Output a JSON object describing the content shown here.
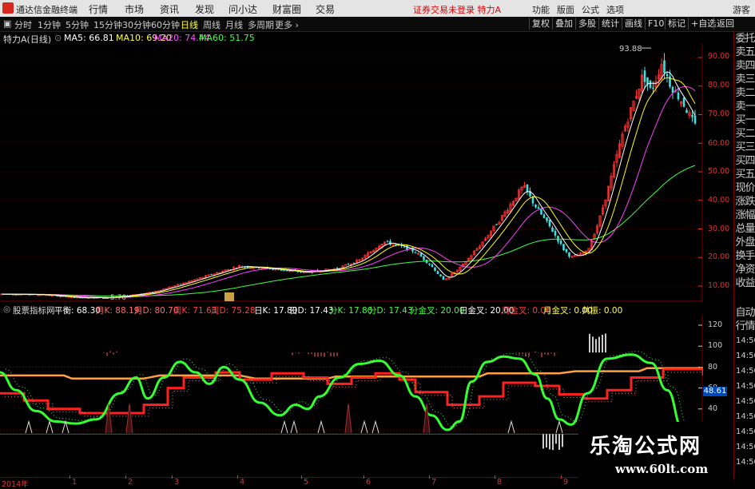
{
  "titlebar": {
    "app_name": "通达信金融终端",
    "menus": [
      "行情",
      "市场",
      "资讯",
      "发现",
      "问小达",
      "财富圈",
      "交易"
    ],
    "warning": "证券交易未登录",
    "stock": "特力A",
    "right_menus": [
      "功能",
      "版面",
      "公式",
      "选项"
    ],
    "guest": "游客"
  },
  "periods": [
    "分时",
    "1分钟",
    "5分钟",
    "15分钟",
    "30分钟",
    "60分钟",
    "日线",
    "周线",
    "月线",
    "多周期",
    "更多"
  ],
  "active_period": "日线",
  "toolbar_buttons": [
    "复权",
    "叠加",
    "多股",
    "统计",
    "画线",
    "F10",
    "标记",
    "+自选",
    "返回"
  ],
  "main_header": {
    "stock_label": "特力A(日线)",
    "ma5": "MA5: 66.81",
    "ma10": "MA10: 69.20",
    "ma20": "MA20: 74.44",
    "ma60": "MA60: 51.75"
  },
  "price_axis": [
    "90.00",
    "80.00",
    "70.00",
    "60.00",
    "50.00",
    "40.00",
    "30.00",
    "20.00",
    "10.00"
  ],
  "peak_label": "93.88",
  "low_label": "5.70",
  "indicator_header": {
    "name": "股票指标网",
    "items": [
      {
        "label": "平衡: 68.30",
        "color": "#ffffff"
      },
      {
        "label": "月K: 88.19",
        "color": "#ff6b6b"
      },
      {
        "label": "月D: 80.70",
        "color": "#ff6b6b"
      },
      {
        "label": "周K: 71.63",
        "color": "#ff4040"
      },
      {
        "label": "周D: 75.28",
        "color": "#ff4040"
      },
      {
        "label": "日K: 17.80",
        "color": "#ffffff"
      },
      {
        "label": "日D: 17.43",
        "color": "#ffffff"
      },
      {
        "label": "分K: 17.80",
        "color": "#44ff44"
      },
      {
        "label": "分D: 17.43",
        "color": "#44ff44"
      },
      {
        "label": "分金叉: 20.00",
        "color": "#44ff44"
      },
      {
        "label": "日金叉: 20.00",
        "color": "#ffffff"
      },
      {
        "label": "周金叉: 0.00",
        "color": "#ff4040"
      },
      {
        "label": "月金叉: 0.00",
        "color": "#ffff44"
      },
      {
        "label": "共振: 0.00",
        "color": "#ffff44"
      }
    ]
  },
  "indicator_axis": [
    "120",
    "100",
    "80",
    "60",
    "40",
    "20"
  ],
  "indicator_value_box": "48.61",
  "right_panel": [
    "委托",
    "卖五",
    "卖四",
    "卖三",
    "卖二",
    "卖一",
    "买一",
    "买二",
    "买三",
    "买四",
    "买五",
    "现价",
    "涨跌",
    "涨幅",
    "总量",
    "外盘",
    "换手",
    "净资",
    "收益"
  ],
  "right_panel_bottom": [
    "自动",
    "行情",
    "14:50",
    "14:50",
    "14:50",
    "14:50",
    "14:50",
    "14:50",
    "14:50",
    "14:50",
    "14:50"
  ],
  "x_axis": [
    "2014年",
    "1",
    "2",
    "3",
    "4",
    "5",
    "6",
    "7",
    "8",
    "9"
  ],
  "watermark": {
    "name": "乐淘公式网",
    "url": "www.60lt.com"
  },
  "colors": {
    "up": "#ff3030",
    "down": "#40e0e0",
    "ma5": "#ffffff",
    "ma10": "#ffff00",
    "ma20": "#ff40ff",
    "ma60": "#40ff40",
    "fast_line": "#33ff33",
    "week_line": "#ff2020",
    "month_line": "#ffa040"
  }
}
